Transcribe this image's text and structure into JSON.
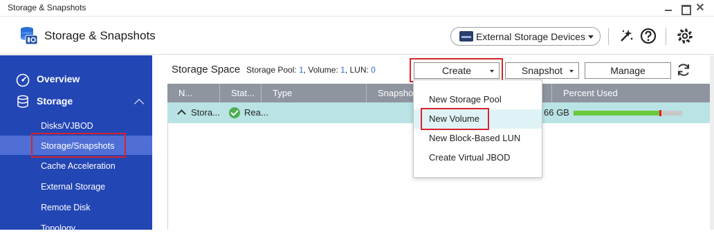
{
  "window": {
    "title": "Storage & Snapshots",
    "min_icon": "minimize-icon",
    "max_icon": "maximize-icon",
    "close_label": "✕"
  },
  "header": {
    "app_title": "Storage & Snapshots",
    "external_devices_label": "External Storage Devices",
    "icons": [
      "storage-app-icon",
      "drive-icon",
      "caret-down-icon",
      "wizard-icon",
      "help-icon",
      "gear-icon"
    ]
  },
  "sidebar": {
    "items": [
      {
        "label": "Overview",
        "icon": "speedometer-icon"
      },
      {
        "label": "Storage",
        "icon": "database-icon"
      },
      {
        "label": "Disks/VJBOD"
      },
      {
        "label": "Storage/Snapshots"
      },
      {
        "label": "Cache Acceleration"
      },
      {
        "label": "External Storage"
      },
      {
        "label": "Remote Disk"
      },
      {
        "label": "Topology"
      }
    ],
    "active_color": "#4f6fd6",
    "bg_color": "#2346b5"
  },
  "main": {
    "title": "Storage Space",
    "summary_prefix_pool": "Storage Pool: ",
    "pool_count": "1",
    "summary_prefix_volume": ", Volume: ",
    "volume_count": "1",
    "summary_prefix_lun": ", LUN: ",
    "lun_count": "0",
    "toolbar": {
      "create_label": "Create",
      "snapshot_label": "Snapshot",
      "manage_label": "Manage",
      "refresh_icon": "refresh-icon"
    },
    "table": {
      "columns": [
        "N...",
        "Stat...",
        "Type",
        "Snapshot",
        "Percent Used"
      ],
      "rows": [
        {
          "name": "Stora...",
          "status": "Rea...",
          "capacity": "66 GB",
          "percent_used": 0.79
        }
      ]
    },
    "create_menu": {
      "items": [
        "New Storage Pool",
        "New Volume",
        "New Block-Based LUN",
        "Create Virtual JBOD"
      ]
    }
  },
  "colors": {
    "highlight_red": "#d8232a",
    "table_header": "#8e959f",
    "row_selected": "#b9e3e5",
    "bar_fill": "#6cc93c",
    "bar_marker": "#e02020",
    "number_blue": "#2a6bd8"
  }
}
